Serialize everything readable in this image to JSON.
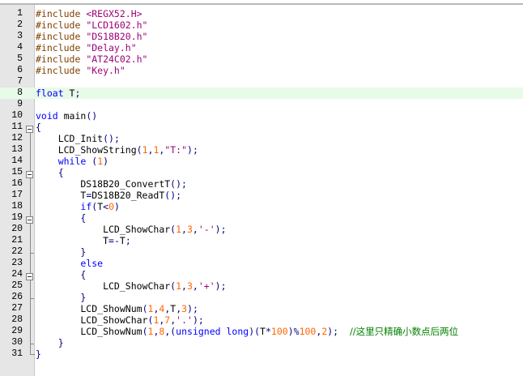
{
  "editor": {
    "highlighted_line": 8,
    "colors": {
      "preprocessor": "#804000",
      "string": "#9d0076",
      "keyword": "#0000ff",
      "number": "#ff6600",
      "operator": "#000080",
      "comment": "#008000",
      "highlight": "#e8fae8"
    },
    "lines": [
      {
        "n": "1",
        "tokens": [
          {
            "t": "pp",
            "v": "#include "
          },
          {
            "t": "str",
            "v": "<REGX52.H>"
          }
        ]
      },
      {
        "n": "2",
        "tokens": [
          {
            "t": "pp",
            "v": "#include "
          },
          {
            "t": "str",
            "v": "\"LCD1602.h\""
          }
        ]
      },
      {
        "n": "3",
        "tokens": [
          {
            "t": "pp",
            "v": "#include "
          },
          {
            "t": "str",
            "v": "\"DS18B20.h\""
          }
        ]
      },
      {
        "n": "4",
        "tokens": [
          {
            "t": "pp",
            "v": "#include "
          },
          {
            "t": "str",
            "v": "\"Delay.h\""
          }
        ]
      },
      {
        "n": "5",
        "tokens": [
          {
            "t": "pp",
            "v": "#include "
          },
          {
            "t": "str",
            "v": "\"AT24C02.h\""
          }
        ]
      },
      {
        "n": "6",
        "tokens": [
          {
            "t": "pp",
            "v": "#include "
          },
          {
            "t": "str",
            "v": "\"Key.h\""
          }
        ]
      },
      {
        "n": "7",
        "tokens": []
      },
      {
        "n": "8",
        "tokens": [
          {
            "t": "kw",
            "v": "float"
          },
          {
            "t": "pl",
            "v": " T"
          },
          {
            "t": "op",
            "v": ";"
          }
        ]
      },
      {
        "n": "9",
        "tokens": []
      },
      {
        "n": "10",
        "tokens": [
          {
            "t": "kw",
            "v": "void"
          },
          {
            "t": "pl",
            "v": " main"
          },
          {
            "t": "op",
            "v": "()"
          }
        ]
      },
      {
        "n": "11",
        "tokens": [
          {
            "t": "op",
            "v": "{"
          }
        ]
      },
      {
        "n": "12",
        "tokens": [
          {
            "t": "pl",
            "v": "    LCD_Init"
          },
          {
            "t": "op",
            "v": "();"
          }
        ]
      },
      {
        "n": "13",
        "tokens": [
          {
            "t": "pl",
            "v": "    LCD_ShowString"
          },
          {
            "t": "op",
            "v": "("
          },
          {
            "t": "num",
            "v": "1"
          },
          {
            "t": "op",
            "v": ","
          },
          {
            "t": "num",
            "v": "1"
          },
          {
            "t": "op",
            "v": ","
          },
          {
            "t": "str",
            "v": "\"T:\""
          },
          {
            "t": "op",
            "v": ");"
          }
        ]
      },
      {
        "n": "14",
        "tokens": [
          {
            "t": "pl",
            "v": "    "
          },
          {
            "t": "kw",
            "v": "while"
          },
          {
            "t": "pl",
            "v": " "
          },
          {
            "t": "op",
            "v": "("
          },
          {
            "t": "num",
            "v": "1"
          },
          {
            "t": "op",
            "v": ")"
          }
        ]
      },
      {
        "n": "15",
        "tokens": [
          {
            "t": "pl",
            "v": "    "
          },
          {
            "t": "op",
            "v": "{"
          }
        ]
      },
      {
        "n": "16",
        "tokens": [
          {
            "t": "pl",
            "v": "        DS18B20_ConvertT"
          },
          {
            "t": "op",
            "v": "();"
          }
        ]
      },
      {
        "n": "17",
        "tokens": [
          {
            "t": "pl",
            "v": "        T"
          },
          {
            "t": "op",
            "v": "="
          },
          {
            "t": "pl",
            "v": "DS18B20_ReadT"
          },
          {
            "t": "op",
            "v": "();"
          }
        ]
      },
      {
        "n": "18",
        "tokens": [
          {
            "t": "pl",
            "v": "        "
          },
          {
            "t": "kw",
            "v": "if"
          },
          {
            "t": "op",
            "v": "("
          },
          {
            "t": "pl",
            "v": "T"
          },
          {
            "t": "op",
            "v": "<"
          },
          {
            "t": "num",
            "v": "0"
          },
          {
            "t": "op",
            "v": ")"
          }
        ]
      },
      {
        "n": "19",
        "tokens": [
          {
            "t": "pl",
            "v": "        "
          },
          {
            "t": "op",
            "v": "{"
          }
        ]
      },
      {
        "n": "20",
        "tokens": [
          {
            "t": "pl",
            "v": "            LCD_ShowChar"
          },
          {
            "t": "op",
            "v": "("
          },
          {
            "t": "num",
            "v": "1"
          },
          {
            "t": "op",
            "v": ","
          },
          {
            "t": "num",
            "v": "3"
          },
          {
            "t": "op",
            "v": ","
          },
          {
            "t": "str",
            "v": "'-'"
          },
          {
            "t": "op",
            "v": ");"
          }
        ]
      },
      {
        "n": "21",
        "tokens": [
          {
            "t": "pl",
            "v": "            T"
          },
          {
            "t": "op",
            "v": "=-"
          },
          {
            "t": "pl",
            "v": "T"
          },
          {
            "t": "op",
            "v": ";"
          }
        ]
      },
      {
        "n": "22",
        "tokens": [
          {
            "t": "pl",
            "v": "        "
          },
          {
            "t": "op",
            "v": "}"
          }
        ]
      },
      {
        "n": "23",
        "tokens": [
          {
            "t": "pl",
            "v": "        "
          },
          {
            "t": "kw",
            "v": "else"
          }
        ]
      },
      {
        "n": "24",
        "tokens": [
          {
            "t": "pl",
            "v": "        "
          },
          {
            "t": "op",
            "v": "{"
          }
        ]
      },
      {
        "n": "25",
        "tokens": [
          {
            "t": "pl",
            "v": "            LCD_ShowChar"
          },
          {
            "t": "op",
            "v": "("
          },
          {
            "t": "num",
            "v": "1"
          },
          {
            "t": "op",
            "v": ","
          },
          {
            "t": "num",
            "v": "3"
          },
          {
            "t": "op",
            "v": ","
          },
          {
            "t": "str",
            "v": "'+'"
          },
          {
            "t": "op",
            "v": ");"
          }
        ]
      },
      {
        "n": "26",
        "tokens": [
          {
            "t": "pl",
            "v": "        "
          },
          {
            "t": "op",
            "v": "}"
          }
        ]
      },
      {
        "n": "27",
        "tokens": [
          {
            "t": "pl",
            "v": "        LCD_ShowNum"
          },
          {
            "t": "op",
            "v": "("
          },
          {
            "t": "num",
            "v": "1"
          },
          {
            "t": "op",
            "v": ","
          },
          {
            "t": "num",
            "v": "4"
          },
          {
            "t": "op",
            "v": ","
          },
          {
            "t": "pl",
            "v": "T"
          },
          {
            "t": "op",
            "v": ","
          },
          {
            "t": "num",
            "v": "3"
          },
          {
            "t": "op",
            "v": ");"
          }
        ]
      },
      {
        "n": "28",
        "tokens": [
          {
            "t": "pl",
            "v": "        LCD_ShowChar"
          },
          {
            "t": "op",
            "v": "("
          },
          {
            "t": "num",
            "v": "1"
          },
          {
            "t": "op",
            "v": ","
          },
          {
            "t": "num",
            "v": "7"
          },
          {
            "t": "op",
            "v": ","
          },
          {
            "t": "str",
            "v": "'.'"
          },
          {
            "t": "op",
            "v": ");"
          }
        ]
      },
      {
        "n": "29",
        "tokens": [
          {
            "t": "pl",
            "v": "        LCD_ShowNum"
          },
          {
            "t": "op",
            "v": "("
          },
          {
            "t": "num",
            "v": "1"
          },
          {
            "t": "op",
            "v": ","
          },
          {
            "t": "num",
            "v": "8"
          },
          {
            "t": "op",
            "v": ",("
          },
          {
            "t": "kw",
            "v": "unsigned long"
          },
          {
            "t": "op",
            "v": ")("
          },
          {
            "t": "pl",
            "v": "T"
          },
          {
            "t": "op",
            "v": "*"
          },
          {
            "t": "num",
            "v": "100"
          },
          {
            "t": "op",
            "v": ")%"
          },
          {
            "t": "num",
            "v": "100"
          },
          {
            "t": "op",
            "v": ","
          },
          {
            "t": "num",
            "v": "2"
          },
          {
            "t": "op",
            "v": ");"
          },
          {
            "t": "pl",
            "v": "  "
          },
          {
            "t": "cm",
            "v": "//这里只精确小数点后两位"
          }
        ]
      },
      {
        "n": "30",
        "tokens": [
          {
            "t": "pl",
            "v": "    "
          },
          {
            "t": "op",
            "v": "}"
          }
        ]
      },
      {
        "n": "31",
        "tokens": [
          {
            "t": "op",
            "v": "}"
          }
        ]
      }
    ]
  }
}
